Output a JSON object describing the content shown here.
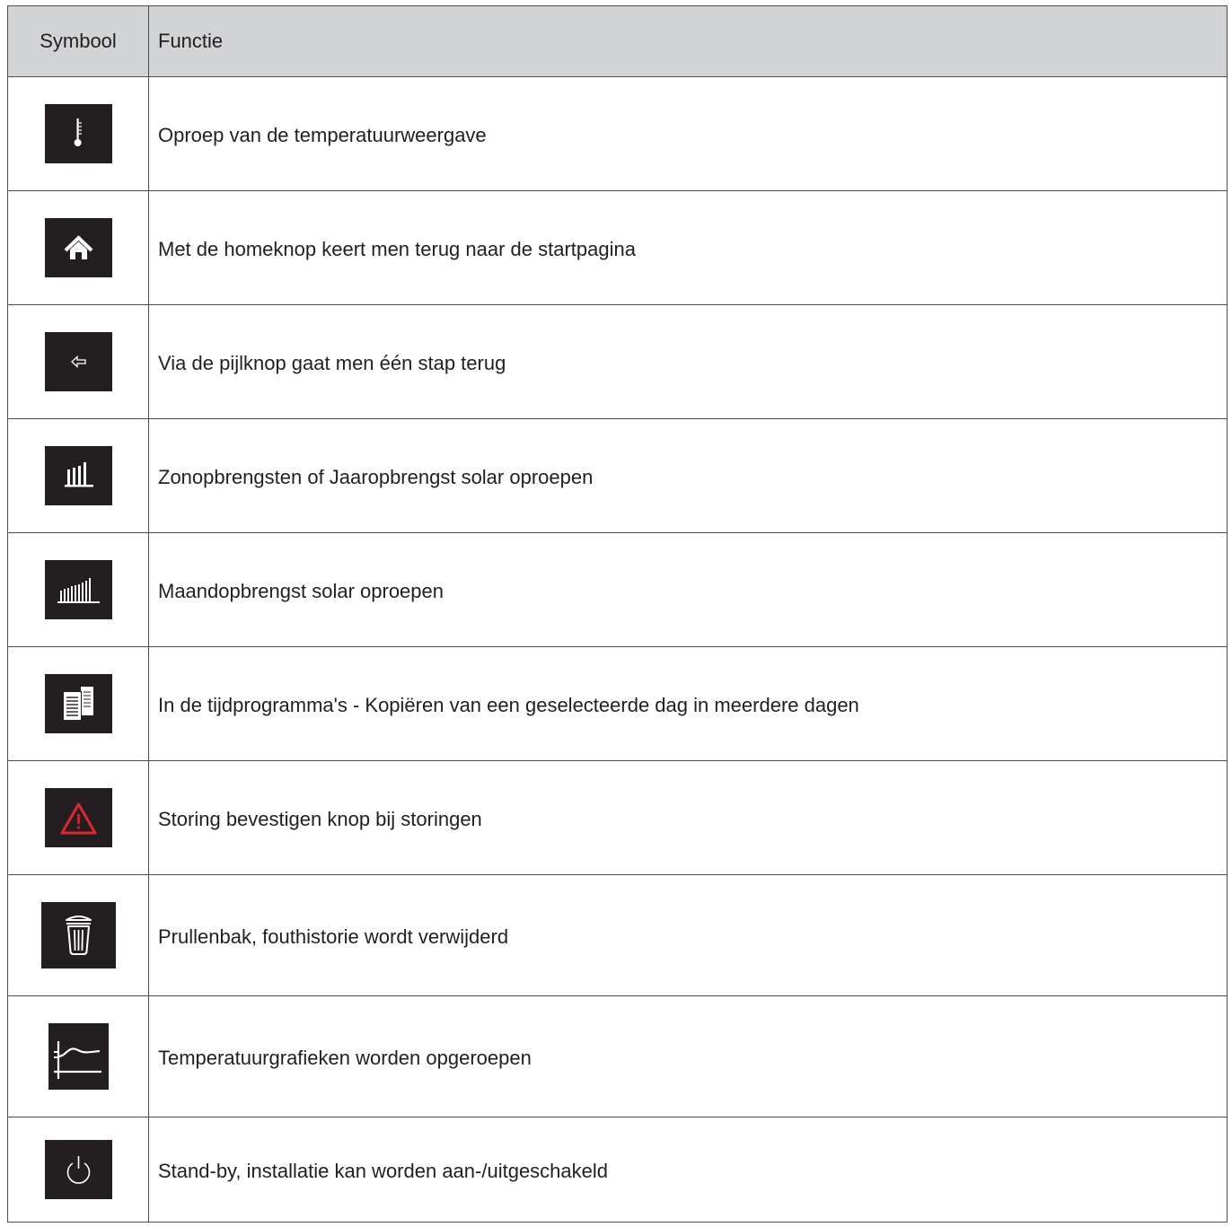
{
  "table": {
    "headers": {
      "symbol": "Symbool",
      "function": "Functie"
    },
    "rows": [
      {
        "icon": "thermometer-icon",
        "description": "Oproep van de temperatuurweergave"
      },
      {
        "icon": "home-icon",
        "description": "Met de homeknop keert men terug naar de startpagina"
      },
      {
        "icon": "back-arrow-icon",
        "description": "Via de pijlknop gaat men één stap terug"
      },
      {
        "icon": "yearly-yield-bars-icon",
        "description": "Zonopbrengsten of Jaaropbrengst solar oproepen"
      },
      {
        "icon": "monthly-yield-bars-icon",
        "description": "Maandopbrengst solar oproepen"
      },
      {
        "icon": "copy-documents-icon",
        "description": "In de tijdprogramma's - Kopiëren van een geselecteerde dag in meerdere dagen"
      },
      {
        "icon": "warning-triangle-icon",
        "description": "Storing bevestigen knop bij storingen"
      },
      {
        "icon": "trash-bin-icon",
        "description": "Prullenbak, fouthistorie wordt verwijderd"
      },
      {
        "icon": "temperature-graph-icon",
        "description": "Temperatuurgrafieken worden opgeroepen"
      },
      {
        "icon": "power-icon",
        "description": "Stand-by, installatie kan worden aan-/uitgeschakeld"
      }
    ]
  },
  "colors": {
    "header_bg": "#d2d3d4",
    "icon_bg": "#231f20",
    "icon_fg": "#ffffff",
    "warning": "#e1262d",
    "border": "#4d4d4f"
  }
}
